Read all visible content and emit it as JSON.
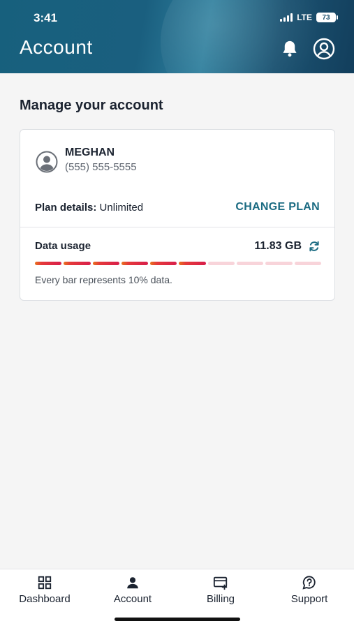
{
  "status_bar": {
    "time": "3:41",
    "network": "LTE",
    "battery": "73"
  },
  "header": {
    "title": "Account",
    "icons": [
      "bell-icon",
      "profile-icon"
    ]
  },
  "main": {
    "section_title": "Manage your account"
  },
  "account_card": {
    "name": "MEGHAN",
    "phone": "(555) 555-5555",
    "plan_label": "Plan details:",
    "plan_value": "Unlimited",
    "change_plan_label": "CHANGE PLAN",
    "data_usage_label": "Data usage",
    "data_usage_value": "11.83 GB",
    "usage_filled_bars": 6,
    "usage_total_bars": 10,
    "usage_note": "Every bar represents 10% data."
  },
  "bottom_nav": {
    "items": [
      {
        "label": "Dashboard",
        "icon": "dashboard-icon"
      },
      {
        "label": "Account",
        "icon": "account-icon"
      },
      {
        "label": "Billing",
        "icon": "billing-icon"
      },
      {
        "label": "Support",
        "icon": "support-icon"
      }
    ]
  },
  "colors": {
    "accent": "#1b6b82",
    "header_bg": "#17607d",
    "usage_fill": "#e53a3a",
    "usage_empty": "#f8d4da"
  }
}
